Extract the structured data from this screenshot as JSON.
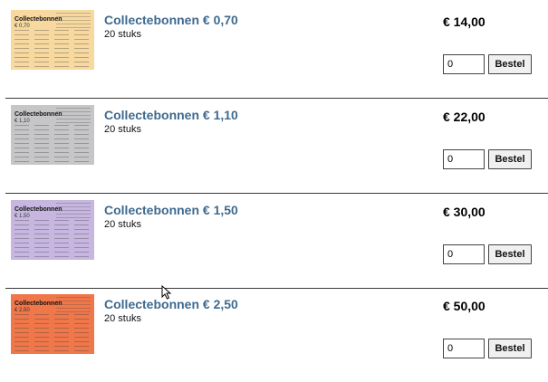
{
  "products": [
    {
      "title": "Collectebonnen € 0,70",
      "subtitle": "20 stuks",
      "price": "€ 14,00",
      "quantity": "0",
      "order_label": "Bestel",
      "thumb": {
        "title": "Collectebonnen",
        "value": "€ 0,70",
        "color": "#f7d9a0"
      }
    },
    {
      "title": "Collectebonnen € 1,10",
      "subtitle": "20 stuks",
      "price": "€ 22,00",
      "quantity": "0",
      "order_label": "Bestel",
      "thumb": {
        "title": "Collectebonnen",
        "value": "€ 1,10",
        "color": "#c6c6c9"
      }
    },
    {
      "title": "Collectebonnen € 1,50",
      "subtitle": "20 stuks",
      "price": "€ 30,00",
      "quantity": "0",
      "order_label": "Bestel",
      "thumb": {
        "title": "Collectebonnen",
        "value": "€ 1,50",
        "color": "#c7b7e0"
      }
    },
    {
      "title": "Collectebonnen € 2,50",
      "subtitle": "20 stuks",
      "price": "€ 50,00",
      "quantity": "0",
      "order_label": "Bestel",
      "thumb": {
        "title": "Collectebonnen",
        "value": "€ 2,50",
        "color": "#f0774a"
      }
    }
  ],
  "icons": {
    "cursor": "mouse-pointer-icon"
  }
}
